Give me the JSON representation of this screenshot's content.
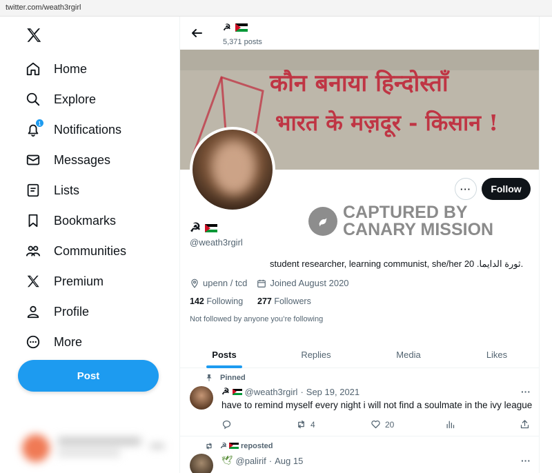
{
  "browser": {
    "url": "twitter.com/weath3rgirl"
  },
  "sidebar": {
    "items": [
      {
        "label": "Home"
      },
      {
        "label": "Explore"
      },
      {
        "label": "Notifications",
        "badge": "1"
      },
      {
        "label": "Messages"
      },
      {
        "label": "Lists"
      },
      {
        "label": "Bookmarks"
      },
      {
        "label": "Communities"
      },
      {
        "label": "Premium"
      },
      {
        "label": "Profile"
      },
      {
        "label": "More"
      }
    ],
    "post_button": "Post"
  },
  "header": {
    "name": "☭",
    "posts_count": "5,371 posts"
  },
  "banner": {
    "line1": "कौन बनाया हिन्दोस्ताँ",
    "line2": "भारत के मज़दूर - किसान !"
  },
  "profile": {
    "name": "☭",
    "handle": "@weath3rgirl",
    "bio": "student researcher, learning communist, she/her ثورة الدايما. 20.",
    "location": "upenn / tcd",
    "joined": "Joined August 2020",
    "following_count": "142",
    "following_label": "Following",
    "followers_count": "277",
    "followers_label": "Followers",
    "not_followed": "Not followed by anyone you’re following",
    "more_label": "···",
    "follow_button": "Follow"
  },
  "watermark": {
    "line1": "CAPTURED BY",
    "line2": "CANARY MISSION"
  },
  "tabs": [
    {
      "label": "Posts",
      "active": true
    },
    {
      "label": "Replies"
    },
    {
      "label": "Media"
    },
    {
      "label": "Likes"
    }
  ],
  "tweets": [
    {
      "context": "Pinned",
      "author_name": "☭",
      "handle": "@weath3rgirl",
      "sep": "·",
      "date": "Sep 19, 2021",
      "text": "have to remind myself every night i will not find a soulmate in the ivy league",
      "replies": "",
      "retweets": "4",
      "likes": "20",
      "more": "···"
    },
    {
      "context": "reposted",
      "context_name": "☭",
      "author_name": "🕊",
      "handle": "@palirif",
      "sep": "·",
      "date": "Aug 15",
      "more": "···"
    }
  ],
  "colors": {
    "accent": "#1d9bf0",
    "text": "#0f1419",
    "muted": "#536471",
    "banner_paint": "#c0283a"
  }
}
